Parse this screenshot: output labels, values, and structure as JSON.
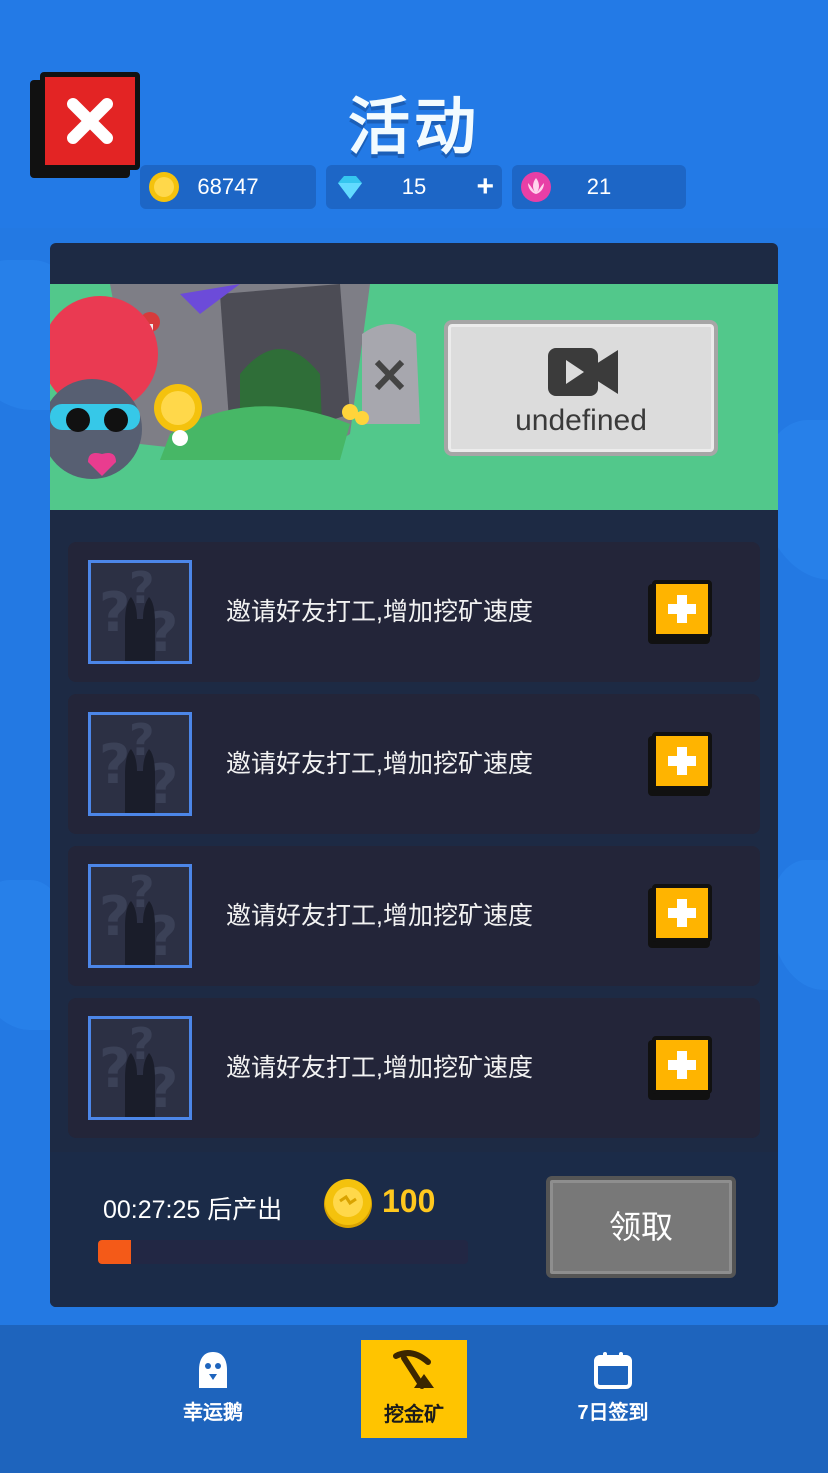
{
  "header": {
    "title": "活动",
    "currencies": [
      {
        "icon": "gold-coin-icon",
        "value": "68747"
      },
      {
        "icon": "diamond-icon",
        "value": "15",
        "has_plus": true
      },
      {
        "icon": "lotus-icon",
        "value": "21"
      }
    ]
  },
  "banner": {
    "video_button_label": "undefined"
  },
  "workers": [
    {
      "label": "邀请好友打工,增加挖矿速度"
    },
    {
      "label": "邀请好友打工,增加挖矿速度"
    },
    {
      "label": "邀请好友打工,增加挖矿速度"
    },
    {
      "label": "邀请好友打工,增加挖矿速度"
    }
  ],
  "mining": {
    "countdown": "00:27:25 后产出",
    "reward": "100",
    "progress": 0.09,
    "claim_label": "领取"
  },
  "tabs": [
    {
      "label": "幸运鹅",
      "icon": "goose-icon",
      "active": false
    },
    {
      "label": "挖金矿",
      "icon": "pickaxe-icon",
      "active": true
    },
    {
      "label": "7日签到",
      "icon": "calendar-icon",
      "active": false
    }
  ],
  "colors": {
    "background": "#2379e3",
    "panel": "#1d2a44",
    "accent_yellow": "#ffb400",
    "close_red": "#e32424",
    "progress": "#f45a18"
  }
}
